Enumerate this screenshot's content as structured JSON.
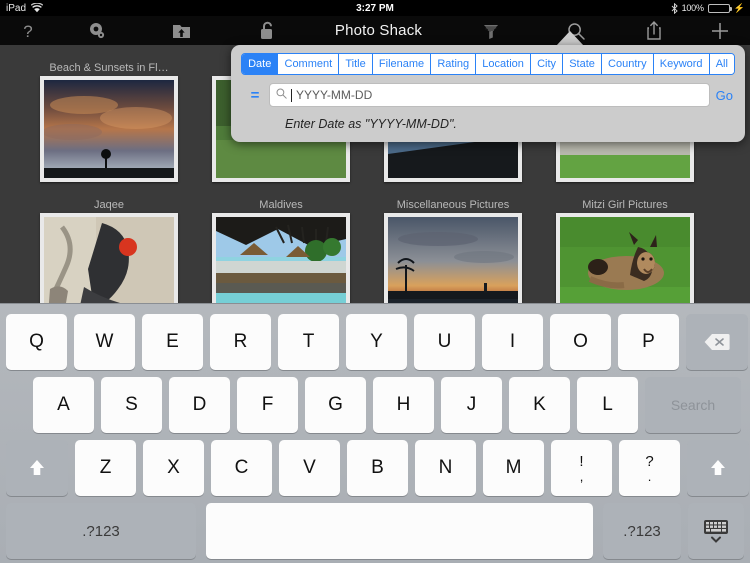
{
  "statusbar": {
    "device": "iPad",
    "wifi_icon": "wifi-icon",
    "time": "3:27 PM",
    "bluetooth_icon": "bluetooth-icon",
    "battery_percent": "100%",
    "battery_icon": "battery-charging-icon"
  },
  "navbar": {
    "title": "Photo Shack",
    "buttons": [
      {
        "name": "help-button",
        "icon": "question-mark-icon"
      },
      {
        "name": "settings-button",
        "icon": "gear-icon"
      },
      {
        "name": "upload-folder-button",
        "icon": "folder-upload-icon"
      },
      {
        "name": "lock-button",
        "icon": "unlocked-padlock-icon"
      },
      {
        "name": "filter-button",
        "icon": "funnel-icon"
      },
      {
        "name": "search-button",
        "icon": "search-icon"
      },
      {
        "name": "share-button",
        "icon": "share-icon"
      },
      {
        "name": "add-button",
        "icon": "plus-icon"
      }
    ]
  },
  "albums": {
    "row1": [
      {
        "label": "Beach & Sunsets in Fl…"
      },
      {
        "label": ""
      },
      {
        "label": ""
      },
      {
        "label": ""
      }
    ],
    "row2": [
      {
        "label": "Jaqee"
      },
      {
        "label": "Maldives"
      },
      {
        "label": "Miscellaneous Pictures"
      },
      {
        "label": "Mitzi Girl Pictures"
      }
    ]
  },
  "popover": {
    "segments": [
      "Date",
      "Comment",
      "Title",
      "Filename",
      "Rating",
      "Location",
      "City",
      "State",
      "Country",
      "Keyword",
      "All"
    ],
    "selected_segment": "Date",
    "operator_label": "=",
    "operator_icon": "equals-icon",
    "search_icon": "search-icon",
    "search_value": "",
    "search_placeholder": "YYYY-MM-DD",
    "go_label": "Go",
    "hint": "Enter Date as \"YYYY-MM-DD\".",
    "accent_color": "#2b82f6"
  },
  "keyboard": {
    "row1": [
      "Q",
      "W",
      "E",
      "R",
      "T",
      "Y",
      "U",
      "I",
      "O",
      "P"
    ],
    "backspace_icon": "backspace-icon",
    "row2": [
      "A",
      "S",
      "D",
      "F",
      "G",
      "H",
      "J",
      "K",
      "L"
    ],
    "search_key_label": "Search",
    "row3": [
      "Z",
      "X",
      "C",
      "V",
      "B",
      "N",
      "M"
    ],
    "punct1": {
      "top": "!",
      "bot": ","
    },
    "punct2": {
      "top": "?",
      "bot": "."
    },
    "shift_left_icon": "shift-arrow-up-icon",
    "shift_right_icon": "shift-arrow-up-icon",
    "numeric_left_label": ".?123",
    "numeric_right_label": ".?123",
    "space_label": "",
    "hide_keyboard_icon": "hide-keyboard-icon"
  }
}
